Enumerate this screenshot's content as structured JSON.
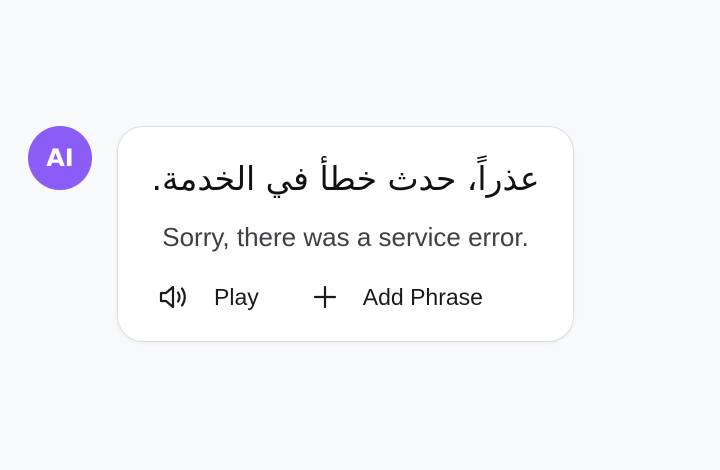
{
  "avatar": {
    "label": "AI",
    "color": "#8b5cf6"
  },
  "message": {
    "arabic_text": "عذراً، حدث خطأ في الخدمة.",
    "translation": "Sorry, there was a service error."
  },
  "actions": {
    "play": {
      "label": "Play",
      "icon": "speaker-icon"
    },
    "add_phrase": {
      "label": "Add Phrase",
      "icon": "plus-icon"
    }
  }
}
